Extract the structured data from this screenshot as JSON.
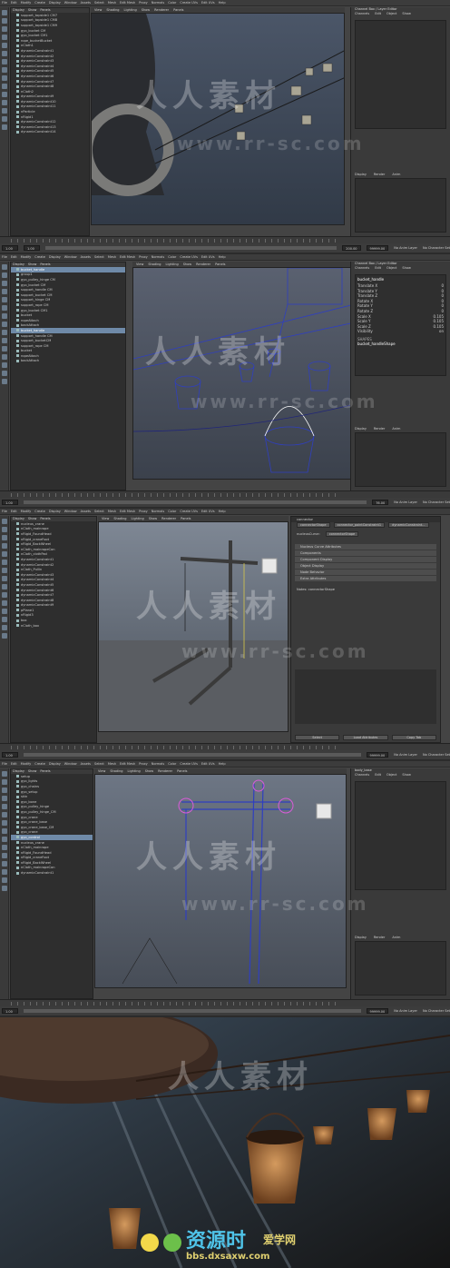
{
  "menu": [
    "File",
    "Edit",
    "Modify",
    "Create",
    "Display",
    "Window",
    "Assets",
    "Select",
    "Mesh",
    "Edit Mesh",
    "Proxy",
    "Normals",
    "Color",
    "Create UVs",
    "Edit UVs",
    "Help"
  ],
  "panel_menu": [
    "Display",
    "Show",
    "Panels"
  ],
  "viewport_menu": [
    "View",
    "Shading",
    "Lighting",
    "Show",
    "Renderer",
    "Panels"
  ],
  "channel_box": {
    "title": "Channel Box / Layer Editor",
    "menu": [
      "Channels",
      "Edit",
      "Object",
      "Show"
    ],
    "layer_tabs": [
      "Display",
      "Render",
      "Anim"
    ],
    "layer_menu": [
      "Layers",
      "Options",
      "Help"
    ]
  },
  "panel1": {
    "outliner": [
      "support_topside1 CM7",
      "support_topside1 CM8",
      "support_topside1 CM9",
      "gyo_bucket CM",
      "gyo_bucket CM1",
      "rope_bucketBucket",
      "nCloth1",
      "dynamicConstraint1",
      "dynamicConstraint2",
      "dynamicConstraint3",
      "dynamicConstraint4",
      "dynamicConstraint5",
      "dynamicConstraint6",
      "dynamicConstraint7",
      "dynamicConstraint8",
      "nCloth2",
      "dynamicConstraint9",
      "dynamicConstraint10",
      "dynamicConstraint11",
      "nParticle",
      "nRigid1",
      "dynamicConstraint12",
      "dynamicConstraint13",
      "dynamicConstraint14"
    ],
    "range": {
      "start": "1.00",
      "sub": "1.00",
      "end": "200.00",
      "max": "99999.00",
      "anim": "No Anim Layer",
      "char": "No Character Set"
    }
  },
  "panel2": {
    "outliner": [
      "bucket_handle",
      "group1",
      "gyo_pulley_hinge CM",
      "gyo_bucket CM",
      "support_handle CM",
      "support_bucket CM",
      "support_hinge CM",
      "support_rope CM",
      "gyo_bucket CM1",
      "bucket",
      "ropeAttach",
      "backAttach",
      "bucket_handle",
      "support_handle CM",
      "support_bucketCM",
      "support_rope CM",
      "bucket",
      "ropeAttach",
      "backAttach"
    ],
    "channel_title": "bucket_handle",
    "channels": [
      [
        "Translate X",
        "0"
      ],
      [
        "Translate Y",
        "0"
      ],
      [
        "Translate Z",
        "0"
      ],
      [
        "Rotate X",
        "0"
      ],
      [
        "Rotate Y",
        "0"
      ],
      [
        "Rotate Z",
        "0"
      ],
      [
        "Scale X",
        "0.105"
      ],
      [
        "Scale Y",
        "0.105"
      ],
      [
        "Scale Z",
        "0.105"
      ],
      [
        "Visibility",
        "on"
      ]
    ],
    "shapes": "SHAPES",
    "shape_name": "bucket_handleShape",
    "range": {
      "start": "1.00",
      "end": "76.00",
      "anim": "No Anim Layer",
      "char": "No Character Set"
    }
  },
  "panel3": {
    "outliner": [
      "nucleus_crane",
      "nCloth_mainrope",
      "nRigid_FoundHead",
      "nRigid_craneFoot",
      "nRigid_BackWheel",
      "nCloth_mainropeCon",
      "nCloth_clothPad",
      "dynamicConstraint1",
      "dynamicConstraint2",
      "nCloth_Pullin",
      "dynamicConstraint3",
      "dynamicConstraint4",
      "dynamicConstraint5",
      "dynamicConstraint6",
      "dynamicConstraint7",
      "dynamicConstraint8",
      "dynamicConstraint9",
      "pPlane1",
      "nRigid3",
      "box",
      "nCloth_box"
    ],
    "search": "connector",
    "attr_tabs": [
      "connectorShape",
      "connector_pointConstraint1",
      "dynamicConstraint..."
    ],
    "attr_label": "nucleusCurve:",
    "attr_value": "connectorShape",
    "sections": [
      "Nucleus Curve Attributes",
      "Components",
      "Component Display",
      "Object Display",
      "Node Behavior",
      "Extra Attributes"
    ],
    "notes": "Notes: connectorShape",
    "buttons": [
      "Select",
      "Load Attributes",
      "Copy Tab"
    ],
    "range": {
      "start": "1.00",
      "end": "99999.00",
      "anim": "No Anim Layer",
      "char": "No Character Set"
    }
  },
  "panel4": {
    "outliner": [
      "setup",
      "gyo_lights",
      "gyo_chains",
      "gyo_setup",
      "skin",
      "gyo_bone",
      "gyo_pulley_hinge",
      "gyo_pulley_hinge_CM",
      "gyo_crane",
      "gyo_crane_base",
      "gyo_crane_base_CM",
      "gyo_crane",
      "gyo_control",
      "nucleus_crane",
      "nCloth_mainrope",
      "nRigid_FoundHead",
      "nRigid_craneFoot",
      "nRigid_BackWheel",
      "nCloth_mainropeCon",
      "dynamicConstraint1"
    ],
    "search": "body_base",
    "range": {
      "start": "1.00",
      "end": "99999.00",
      "anim": "No Anim Layer",
      "char": "No Character Set"
    }
  },
  "watermark": {
    "cn": "人人素材",
    "url": "www.rr-sc.com"
  },
  "logo": {
    "cn": "资源时",
    "sub": "爱学网",
    "url": "bbs.dxsaxw.com"
  },
  "colors": {
    "accent": "#6f8aa8",
    "selection_wire": "#d95bd9",
    "wire_blue": "#2f3fbf"
  }
}
